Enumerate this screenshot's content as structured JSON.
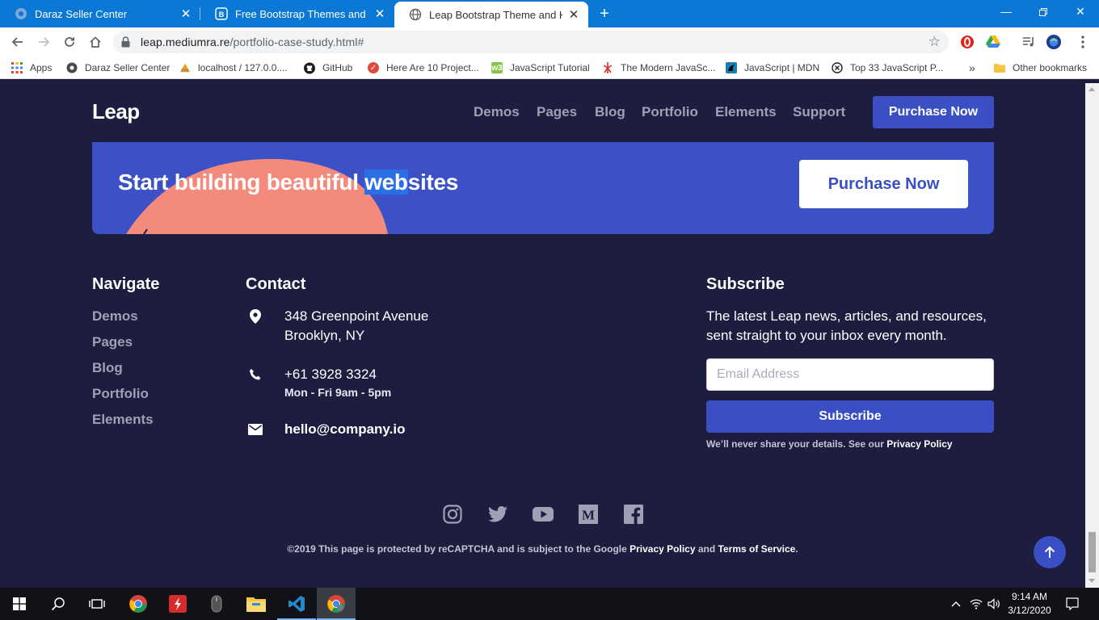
{
  "browser": {
    "tabs": [
      {
        "title": "Daraz Seller Center",
        "icon": "daraz-icon",
        "active": false
      },
      {
        "title": "Free Bootstrap Themes and Web",
        "icon": "bootstrap-icon",
        "active": false
      },
      {
        "title": "Leap Bootstrap Theme and HTML",
        "icon": "globe-icon",
        "active": true
      }
    ],
    "url": {
      "host": "leap.mediumra.re",
      "path": "/portfolio-case-study.html#"
    },
    "bookmarks": [
      {
        "label": "Apps",
        "icon": "apps-grid-icon"
      },
      {
        "label": "Daraz Seller Center",
        "icon": "daraz-icon"
      },
      {
        "label": "localhost / 127.0.0....",
        "icon": "phpmyadmin-icon"
      },
      {
        "label": "GitHub",
        "icon": "github-icon"
      },
      {
        "label": "Here Are 10 Project...",
        "icon": "article-icon"
      },
      {
        "label": "JavaScript Tutorial",
        "icon": "w3-icon"
      },
      {
        "label": "The Modern JavaSc...",
        "icon": "javascript-info-icon"
      },
      {
        "label": "JavaScript | MDN",
        "icon": "mdn-icon"
      },
      {
        "label": "Top 33 JavaScript P...",
        "icon": "x-circle-icon"
      },
      {
        "label": "»",
        "icon": ""
      },
      {
        "label": "Other bookmarks",
        "icon": "folder-icon"
      }
    ]
  },
  "site": {
    "logo": "Leap",
    "nav": [
      "Demos",
      "Pages",
      "Blog",
      "Portfolio",
      "Elements",
      "Support"
    ],
    "purchase_button": "Purchase Now",
    "cta": {
      "headline_before": "Start building beautiful ",
      "headline_highlight": "web",
      "headline_after": "sites",
      "button": "Purchase Now",
      "accent_color": "#f48a7c"
    },
    "footer": {
      "navigate": {
        "heading": "Navigate",
        "links": [
          "Demos",
          "Pages",
          "Blog",
          "Portfolio",
          "Elements"
        ]
      },
      "contact": {
        "heading": "Contact",
        "address_line1": "348 Greenpoint Avenue",
        "address_line2": "Brooklyn, NY",
        "phone": "+61 3928 3324",
        "hours": "Mon - Fri 9am - 5pm",
        "email": "hello@company.io"
      },
      "subscribe": {
        "heading": "Subscribe",
        "text": "The latest Leap news, articles, and resources, sent straight to your inbox every month.",
        "email_placeholder": "Email Address",
        "button": "Subscribe",
        "note_prefix": "We’ll never share your details. See our ",
        "note_link": "Privacy Policy"
      },
      "social": [
        "instagram-icon",
        "twitter-icon",
        "youtube-icon",
        "medium-icon",
        "facebook-icon"
      ],
      "legal": {
        "prefix": "©2019 This page is protected by reCAPTCHA and is subject to the Google ",
        "privacy": "Privacy Policy",
        "and": " and ",
        "terms": "Terms of Service",
        "suffix": "."
      }
    }
  },
  "taskbar": {
    "time": "9:14 AM",
    "date": "3/12/2020"
  },
  "colors": {
    "page_bg": "#1c1d3f",
    "primary": "#3a4fc3",
    "cta_bg": "#3c51c6",
    "chrome_blue": "#0a78d4"
  }
}
